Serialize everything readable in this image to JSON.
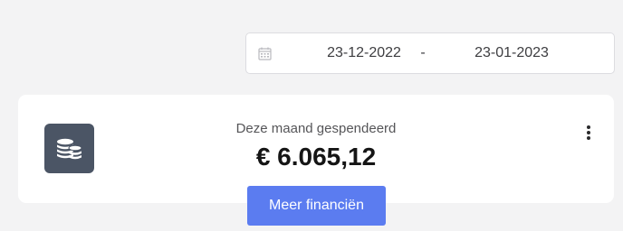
{
  "date_range": {
    "start": "23-12-2022",
    "separator": "-",
    "end": "23-01-2023",
    "icon": "calendar-icon"
  },
  "spending_card": {
    "label": "Deze maand gespendeerd",
    "value": "€ 6.065,12",
    "icon": "coins-icon",
    "menu_icon": "more-vertical-icon",
    "tile_color": "#4b5565"
  },
  "actions": {
    "more_finances_label": "Meer financiën",
    "button_color": "#5b7cf0"
  }
}
